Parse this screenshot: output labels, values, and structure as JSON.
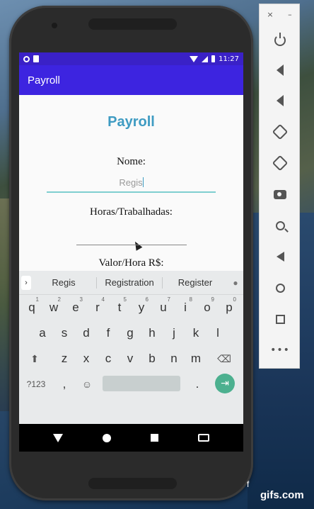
{
  "status_bar": {
    "time": "11:27"
  },
  "app_bar": {
    "title": "Payroll"
  },
  "form": {
    "heading": "Payroll",
    "nome_label": "Nome:",
    "nome_value": "Regis",
    "horas_label": "Horas/Trabalhadas:",
    "horas_value": "",
    "valor_label": "Valor/Hora R$:"
  },
  "keyboard": {
    "suggestions": [
      "Regis",
      "Registration",
      "Register"
    ],
    "row1": [
      {
        "key": "q",
        "alt": "1"
      },
      {
        "key": "w",
        "alt": "2"
      },
      {
        "key": "e",
        "alt": "3"
      },
      {
        "key": "r",
        "alt": "4"
      },
      {
        "key": "t",
        "alt": "5"
      },
      {
        "key": "y",
        "alt": "6"
      },
      {
        "key": "u",
        "alt": "7"
      },
      {
        "key": "i",
        "alt": "8"
      },
      {
        "key": "o",
        "alt": "9"
      },
      {
        "key": "p",
        "alt": "0"
      }
    ],
    "row2": [
      "a",
      "s",
      "d",
      "f",
      "g",
      "h",
      "j",
      "k",
      "l"
    ],
    "row3": [
      "z",
      "x",
      "c",
      "v",
      "b",
      "n",
      "m"
    ],
    "symbols_key": "?123",
    "comma_key": ",",
    "period_key": "."
  },
  "emulator": {
    "close": "×",
    "minimize": "–"
  },
  "watermark": {
    "text": "gifs.com",
    "stray_char": "f"
  }
}
